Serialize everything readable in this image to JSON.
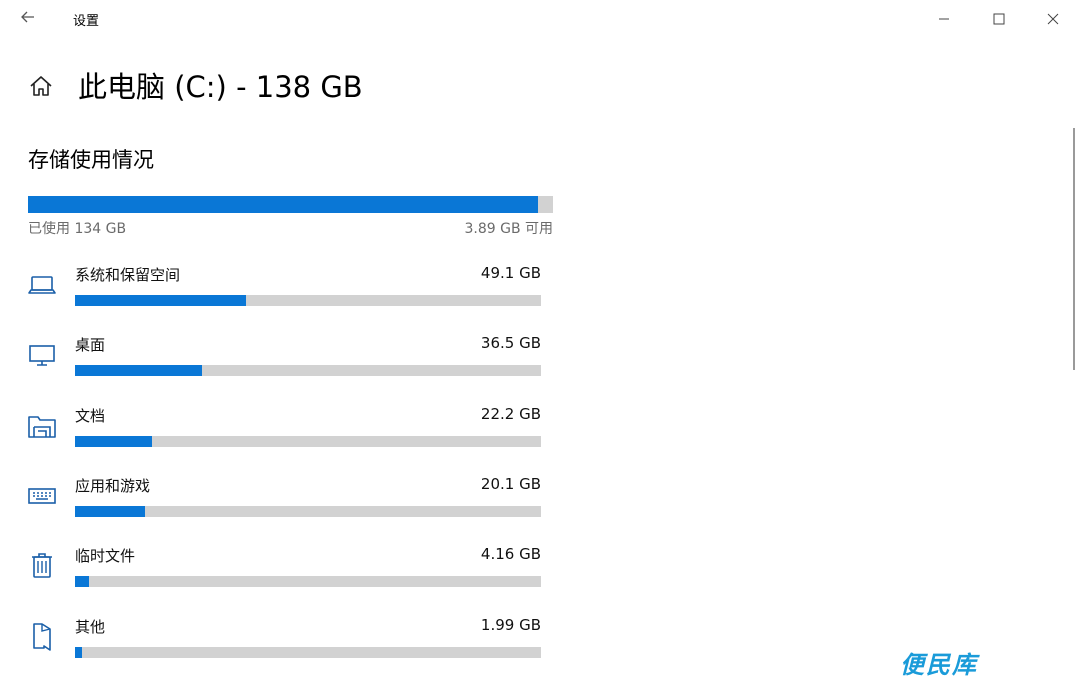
{
  "window": {
    "title": "设置",
    "back_icon": "back-arrow-icon",
    "controls": [
      "minimize-icon",
      "maximize-icon",
      "close-icon"
    ]
  },
  "page": {
    "title": "此电脑 (C:) - 138 GB",
    "home_icon": "home-icon"
  },
  "storage": {
    "section_title": "存储使用情况",
    "used_label": "已使用 134 GB",
    "free_label": "3.89 GB 可用",
    "used_fraction": 0.972,
    "accent_color": "#0a77d6",
    "track_color": "#d2d2d2"
  },
  "categories": [
    {
      "label": "系统和保留空间",
      "size": "49.1 GB",
      "fraction": 0.367,
      "icon": "laptop-icon"
    },
    {
      "label": "桌面",
      "size": "36.5 GB",
      "fraction": 0.272,
      "icon": "monitor-icon"
    },
    {
      "label": "文档",
      "size": "22.2 GB",
      "fraction": 0.166,
      "icon": "folder-icon"
    },
    {
      "label": "应用和游戏",
      "size": "20.1 GB",
      "fraction": 0.15,
      "icon": "keyboard-icon"
    },
    {
      "label": "临时文件",
      "size": "4.16 GB",
      "fraction": 0.031,
      "icon": "trash-icon"
    },
    {
      "label": "其他",
      "size": "1.99 GB",
      "fraction": 0.015,
      "icon": "other-file-icon"
    }
  ],
  "watermark": "便民库"
}
